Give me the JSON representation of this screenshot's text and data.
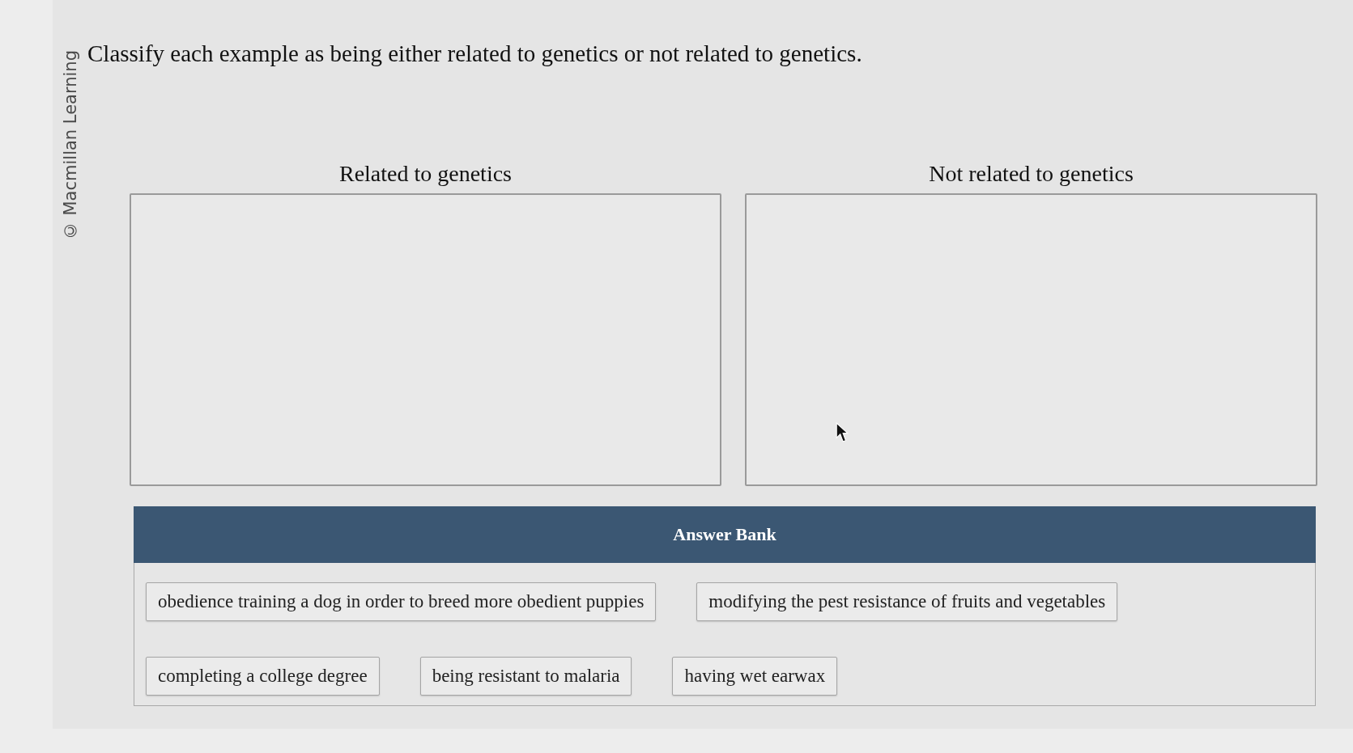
{
  "copyright": "© Macmillan Learning",
  "question": "Classify each example as being either related to genetics or not related to genetics.",
  "bins": [
    {
      "heading": "Related to genetics"
    },
    {
      "heading": "Not related to genetics"
    }
  ],
  "answer_bank": {
    "title": "Answer Bank",
    "rows": [
      {
        "items": [
          "obedience training a dog in order to breed more obedient puppies",
          "modifying the pest resistance of fruits and vegetables"
        ]
      },
      {
        "items": [
          "completing a college degree",
          "being resistant to malaria",
          "having wet earwax"
        ]
      }
    ]
  }
}
